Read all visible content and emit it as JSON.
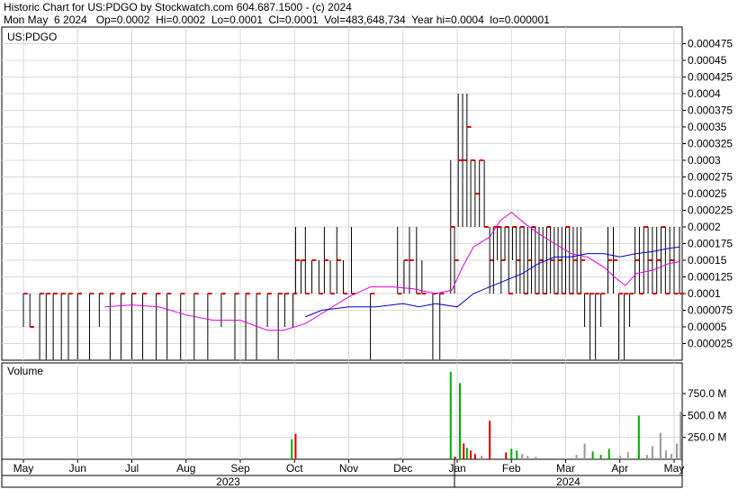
{
  "header": {
    "line1": "Historic Chart for US:PDGO by Stockwatch.com 604.687.1500 - (c) 2024",
    "line2": "Mon May  6 2024   Op=0.0002  Hi=0.0002  Lo=0.0001  Cl=0.0001  Vol=483,648,734  Year hi=0.0004  lo=0.000001"
  },
  "chart_data": [
    {
      "type": "line",
      "title": "US:PDGO",
      "ylim": [
        0,
        0.0005
      ],
      "y_ticks": [
        "0.000475",
        "0.00045",
        "0.000425",
        "0.0004",
        "0.000375",
        "0.00035",
        "0.000325",
        "0.0003",
        "0.000275",
        "0.00025",
        "0.000225",
        "0.0002",
        "0.000175",
        "0.00015",
        "0.000125",
        "0.0001",
        "0.000075",
        "0.00005",
        "0.000025"
      ],
      "y_tick_values": [
        0.000475,
        0.00045,
        0.000425,
        0.0004,
        0.000375,
        0.00035,
        0.000325,
        0.0003,
        0.000275,
        0.00025,
        0.000225,
        0.0002,
        0.000175,
        0.00015,
        0.000125,
        0.0001,
        7.5e-05,
        5e-05,
        2.5e-05
      ],
      "x_months": [
        "May",
        "Jun",
        "Jul",
        "Aug",
        "Sep",
        "Oct",
        "Nov",
        "Dec",
        "Jan",
        "Feb",
        "Mar",
        "Apr",
        "May"
      ],
      "x_years": [
        "2023",
        "2024"
      ],
      "grid": true,
      "colors": {
        "price": "#000000",
        "close_tick": "#dd0000",
        "ma_fast": "#e000e0",
        "ma_slow": "#0000cc"
      },
      "price_bars": [
        {
          "x": 0.0,
          "lo": 5e-05,
          "hi": 0.0001,
          "c": 0.0001
        },
        {
          "x": 0.12,
          "lo": 5e-05,
          "hi": 0.0001,
          "c": 5e-05
        },
        {
          "x": 0.3,
          "lo": 1e-06,
          "hi": 0.0001,
          "c": 0.0001
        },
        {
          "x": 0.42,
          "lo": 1e-06,
          "hi": 0.0001,
          "c": 0.0001
        },
        {
          "x": 0.55,
          "lo": 1e-06,
          "hi": 0.0001,
          "c": 0.0001
        },
        {
          "x": 0.7,
          "lo": 1e-06,
          "hi": 0.0001,
          "c": 0.0001
        },
        {
          "x": 0.83,
          "lo": 1e-06,
          "hi": 0.0001,
          "c": 0.0001
        },
        {
          "x": 1.0,
          "lo": 1e-06,
          "hi": 0.0001,
          "c": 0.0001
        },
        {
          "x": 1.22,
          "lo": 1e-06,
          "hi": 0.0001,
          "c": 0.0001
        },
        {
          "x": 1.4,
          "lo": 5e-05,
          "hi": 0.0001,
          "c": 0.0001
        },
        {
          "x": 1.6,
          "lo": 1e-06,
          "hi": 0.0001,
          "c": 0.0001
        },
        {
          "x": 1.8,
          "lo": 1e-06,
          "hi": 0.0001,
          "c": 0.0001
        },
        {
          "x": 2.0,
          "lo": 1e-06,
          "hi": 0.0001,
          "c": 0.0001
        },
        {
          "x": 2.2,
          "lo": 1e-06,
          "hi": 0.0001,
          "c": 0.0001
        },
        {
          "x": 2.45,
          "lo": 1e-06,
          "hi": 0.0001,
          "c": 0.0001
        },
        {
          "x": 2.65,
          "lo": 1e-06,
          "hi": 0.0001,
          "c": 0.0001
        },
        {
          "x": 2.9,
          "lo": 1e-06,
          "hi": 0.0001,
          "c": 0.0001
        },
        {
          "x": 3.15,
          "lo": 1e-06,
          "hi": 0.0001,
          "c": 0.0001
        },
        {
          "x": 3.4,
          "lo": 1e-06,
          "hi": 0.0001,
          "c": 0.0001
        },
        {
          "x": 3.65,
          "lo": 5e-05,
          "hi": 0.0001,
          "c": 0.0001
        },
        {
          "x": 3.9,
          "lo": 1e-06,
          "hi": 0.0001,
          "c": 0.0001
        },
        {
          "x": 4.1,
          "lo": 1e-06,
          "hi": 0.0001,
          "c": 0.0001
        },
        {
          "x": 4.3,
          "lo": 1e-06,
          "hi": 0.0001,
          "c": 0.0001
        },
        {
          "x": 4.5,
          "lo": 5e-05,
          "hi": 0.0001,
          "c": 0.0001
        },
        {
          "x": 4.7,
          "lo": 1e-06,
          "hi": 0.0001,
          "c": 0.0001
        },
        {
          "x": 4.82,
          "lo": 5e-05,
          "hi": 0.0001,
          "c": 0.0001
        },
        {
          "x": 4.97,
          "lo": 5e-05,
          "hi": 0.0001,
          "c": 0.0001
        },
        {
          "x": 5.02,
          "lo": 0.0001,
          "hi": 0.0002,
          "c": 0.00015
        },
        {
          "x": 5.12,
          "lo": 0.0001,
          "hi": 0.00015,
          "c": 0.00015
        },
        {
          "x": 5.2,
          "lo": 0.0001,
          "hi": 0.0002,
          "c": 0.0001
        },
        {
          "x": 5.32,
          "lo": 0.0001,
          "hi": 0.00015,
          "c": 0.00015
        },
        {
          "x": 5.45,
          "lo": 0.0001,
          "hi": 0.00015,
          "c": 0.0001
        },
        {
          "x": 5.55,
          "lo": 0.0001,
          "hi": 0.0002,
          "c": 0.00015
        },
        {
          "x": 5.66,
          "lo": 0.0001,
          "hi": 0.00015,
          "c": 0.0001
        },
        {
          "x": 5.78,
          "lo": 0.0001,
          "hi": 0.0002,
          "c": 0.00015
        },
        {
          "x": 5.9,
          "lo": 0.0001,
          "hi": 0.00015,
          "c": 0.0001
        },
        {
          "x": 6.05,
          "lo": 0.0001,
          "hi": 0.0002,
          "c": 0.0001
        },
        {
          "x": 6.4,
          "lo": 1e-06,
          "hi": 0.0001,
          "c": 0.0001
        },
        {
          "x": 6.9,
          "lo": 0.0001,
          "hi": 0.0002,
          "c": 0.0001
        },
        {
          "x": 7.02,
          "lo": 0.0001,
          "hi": 0.00015,
          "c": 0.00015
        },
        {
          "x": 7.12,
          "lo": 0.0001,
          "hi": 0.0002,
          "c": 0.00015
        },
        {
          "x": 7.25,
          "lo": 0.0001,
          "hi": 0.0002,
          "c": 0.0001
        },
        {
          "x": 7.35,
          "lo": 0.0001,
          "hi": 0.00015,
          "c": 0.0001
        },
        {
          "x": 7.55,
          "lo": 1e-06,
          "hi": 0.0001,
          "c": 0.0001
        },
        {
          "x": 7.68,
          "lo": 1e-06,
          "hi": 0.0001,
          "c": 0.0001
        },
        {
          "x": 7.88,
          "lo": 0.0001,
          "hi": 0.0003,
          "c": 0.0002
        },
        {
          "x": 7.95,
          "lo": 0.0001,
          "hi": 0.0002,
          "c": 0.00015
        },
        {
          "x": 8.02,
          "lo": 0.0002,
          "hi": 0.0004,
          "c": 0.0003
        },
        {
          "x": 8.1,
          "lo": 0.0002,
          "hi": 0.0004,
          "c": 0.0003
        },
        {
          "x": 8.18,
          "lo": 0.0002,
          "hi": 0.0004,
          "c": 0.00035
        },
        {
          "x": 8.25,
          "lo": 0.0002,
          "hi": 0.0003,
          "c": 0.0003
        },
        {
          "x": 8.33,
          "lo": 0.0002,
          "hi": 0.0003,
          "c": 0.00025
        },
        {
          "x": 8.41,
          "lo": 0.0002,
          "hi": 0.0003,
          "c": 0.0003
        },
        {
          "x": 8.5,
          "lo": 0.0002,
          "hi": 0.0003,
          "c": 0.0002
        },
        {
          "x": 8.6,
          "lo": 0.0001,
          "hi": 0.0002,
          "c": 0.00015
        },
        {
          "x": 8.67,
          "lo": 0.0001,
          "hi": 0.0002,
          "c": 0.0002
        },
        {
          "x": 8.74,
          "lo": 0.00015,
          "hi": 0.0002,
          "c": 0.0002
        },
        {
          "x": 8.81,
          "lo": 0.0001,
          "hi": 0.0002,
          "c": 0.00015
        },
        {
          "x": 8.88,
          "lo": 0.00015,
          "hi": 0.0002,
          "c": 0.0002
        },
        {
          "x": 8.95,
          "lo": 0.0001,
          "hi": 0.0002,
          "c": 0.0001
        },
        {
          "x": 9.02,
          "lo": 0.00015,
          "hi": 0.0002,
          "c": 0.0002
        },
        {
          "x": 9.09,
          "lo": 0.0001,
          "hi": 0.0002,
          "c": 0.00015
        },
        {
          "x": 9.16,
          "lo": 0.0001,
          "hi": 0.0002,
          "c": 0.0002
        },
        {
          "x": 9.23,
          "lo": 0.0001,
          "hi": 0.0002,
          "c": 0.0001
        },
        {
          "x": 9.3,
          "lo": 0.0001,
          "hi": 0.0002,
          "c": 0.00015
        },
        {
          "x": 9.37,
          "lo": 0.0001,
          "hi": 0.0002,
          "c": 0.0002
        },
        {
          "x": 9.44,
          "lo": 0.0001,
          "hi": 0.0002,
          "c": 0.0001
        },
        {
          "x": 9.51,
          "lo": 0.0001,
          "hi": 0.0002,
          "c": 0.00015
        },
        {
          "x": 9.58,
          "lo": 0.0001,
          "hi": 0.0002,
          "c": 0.0001
        },
        {
          "x": 9.65,
          "lo": 0.0001,
          "hi": 0.0002,
          "c": 0.0002
        },
        {
          "x": 9.72,
          "lo": 0.0001,
          "hi": 0.0002,
          "c": 0.00015
        },
        {
          "x": 9.79,
          "lo": 0.0001,
          "hi": 0.0002,
          "c": 0.0001
        },
        {
          "x": 9.86,
          "lo": 0.0001,
          "hi": 0.0002,
          "c": 0.00015
        },
        {
          "x": 9.93,
          "lo": 0.0001,
          "hi": 0.0002,
          "c": 0.0001
        },
        {
          "x": 10.0,
          "lo": 0.0001,
          "hi": 0.0002,
          "c": 0.0002
        },
        {
          "x": 10.07,
          "lo": 0.0001,
          "hi": 0.0002,
          "c": 0.0001
        },
        {
          "x": 10.14,
          "lo": 0.0001,
          "hi": 0.0002,
          "c": 0.00015
        },
        {
          "x": 10.21,
          "lo": 0.0001,
          "hi": 0.0002,
          "c": 0.0001
        },
        {
          "x": 10.28,
          "lo": 0.0001,
          "hi": 0.0002,
          "c": 0.00015
        },
        {
          "x": 10.35,
          "lo": 5e-05,
          "hi": 0.0001,
          "c": 0.0001
        },
        {
          "x": 10.45,
          "lo": 1e-06,
          "hi": 0.0001,
          "c": 0.0001
        },
        {
          "x": 10.55,
          "lo": 1e-06,
          "hi": 0.0001,
          "c": 0.0001
        },
        {
          "x": 10.65,
          "lo": 5e-05,
          "hi": 0.0001,
          "c": 0.0001
        },
        {
          "x": 10.78,
          "lo": 0.0001,
          "hi": 0.0002,
          "c": 0.00015
        },
        {
          "x": 10.88,
          "lo": 0.0001,
          "hi": 0.0002,
          "c": 0.00015
        },
        {
          "x": 10.98,
          "lo": 1e-06,
          "hi": 0.0001,
          "c": 0.0001
        },
        {
          "x": 11.08,
          "lo": 1e-06,
          "hi": 0.0001,
          "c": 0.0001
        },
        {
          "x": 11.18,
          "lo": 5e-05,
          "hi": 0.0001,
          "c": 0.0001
        },
        {
          "x": 11.28,
          "lo": 0.0001,
          "hi": 0.0002,
          "c": 0.00015
        },
        {
          "x": 11.36,
          "lo": 0.0001,
          "hi": 0.0002,
          "c": 0.0001
        },
        {
          "x": 11.44,
          "lo": 0.0001,
          "hi": 0.0002,
          "c": 0.0002
        },
        {
          "x": 11.52,
          "lo": 0.0001,
          "hi": 0.0002,
          "c": 0.00015
        },
        {
          "x": 11.6,
          "lo": 0.0001,
          "hi": 0.0002,
          "c": 0.0001
        },
        {
          "x": 11.68,
          "lo": 0.0001,
          "hi": 0.0002,
          "c": 0.00015
        },
        {
          "x": 11.76,
          "lo": 0.0001,
          "hi": 0.0002,
          "c": 0.0002
        },
        {
          "x": 11.84,
          "lo": 0.0001,
          "hi": 0.0002,
          "c": 0.0001
        },
        {
          "x": 11.92,
          "lo": 0.0001,
          "hi": 0.0002,
          "c": 0.00015
        },
        {
          "x": 12.0,
          "lo": 0.0001,
          "hi": 0.0002,
          "c": 0.0001
        },
        {
          "x": 12.1,
          "lo": 0.0001,
          "hi": 0.0002,
          "c": 0.0001
        }
      ],
      "ma_fast": [
        [
          1.5,
          8e-05
        ],
        [
          2.0,
          8.3e-05
        ],
        [
          2.5,
          8e-05
        ],
        [
          3.0,
          6.8e-05
        ],
        [
          3.5,
          6e-05
        ],
        [
          4.0,
          6e-05
        ],
        [
          4.5,
          4.5e-05
        ],
        [
          4.8,
          4.5e-05
        ],
        [
          5.2,
          5.5e-05
        ],
        [
          5.6,
          7.5e-05
        ],
        [
          6.0,
          9.5e-05
        ],
        [
          6.4,
          0.00011
        ],
        [
          6.8,
          0.00011
        ],
        [
          7.2,
          0.000107
        ],
        [
          7.6,
          0.0001
        ],
        [
          7.9,
          0.000105
        ],
        [
          8.1,
          0.00014
        ],
        [
          8.3,
          0.00017
        ],
        [
          8.6,
          0.000185
        ],
        [
          8.8,
          0.00021
        ],
        [
          9.0,
          0.000222
        ],
        [
          9.25,
          0.000205
        ],
        [
          9.5,
          0.00019
        ],
        [
          9.8,
          0.000175
        ],
        [
          10.1,
          0.00016
        ],
        [
          10.4,
          0.000155
        ],
        [
          10.7,
          0.00014
        ],
        [
          10.9,
          0.000125
        ],
        [
          11.1,
          0.000112
        ],
        [
          11.3,
          0.00013
        ],
        [
          11.6,
          0.000135
        ],
        [
          11.9,
          0.000145
        ],
        [
          12.1,
          0.000148
        ]
      ],
      "ma_slow": [
        [
          5.2,
          6.5e-05
        ],
        [
          5.5,
          7.5e-05
        ],
        [
          6.0,
          8e-05
        ],
        [
          6.5,
          8e-05
        ],
        [
          7.0,
          8.5e-05
        ],
        [
          7.3,
          8e-05
        ],
        [
          7.6,
          8.5e-05
        ],
        [
          8.0,
          8e-05
        ],
        [
          8.3,
          0.0001
        ],
        [
          8.6,
          0.00011
        ],
        [
          8.9,
          0.00012
        ],
        [
          9.2,
          0.00013
        ],
        [
          9.5,
          0.000145
        ],
        [
          9.8,
          0.000155
        ],
        [
          10.1,
          0.000155
        ],
        [
          10.4,
          0.00016
        ],
        [
          10.7,
          0.00016
        ],
        [
          11.0,
          0.000155
        ],
        [
          11.3,
          0.00016
        ],
        [
          11.6,
          0.000163
        ],
        [
          11.9,
          0.000168
        ],
        [
          12.1,
          0.00017
        ]
      ]
    },
    {
      "type": "bar",
      "title": "Volume",
      "ylim": [
        0,
        1100
      ],
      "y_ticks": [
        "750.0 M",
        "500.0 M",
        "250.0 M"
      ],
      "y_tick_values": [
        750,
        500,
        250
      ],
      "unit": "M",
      "colors": {
        "up": "#00aa00",
        "down": "#dd0000",
        "flat": "#999999"
      },
      "bars": [
        {
          "x": 4.95,
          "v": 230,
          "d": "up"
        },
        {
          "x": 5.02,
          "v": 290,
          "d": "down"
        },
        {
          "x": 6.95,
          "v": 20,
          "d": "flat"
        },
        {
          "x": 7.88,
          "v": 1000,
          "d": "up"
        },
        {
          "x": 7.96,
          "v": 30,
          "d": "down"
        },
        {
          "x": 8.05,
          "v": 870,
          "d": "up"
        },
        {
          "x": 8.12,
          "v": 180,
          "d": "down"
        },
        {
          "x": 8.18,
          "v": 130,
          "d": "up"
        },
        {
          "x": 8.25,
          "v": 100,
          "d": "down"
        },
        {
          "x": 8.33,
          "v": 60,
          "d": "down"
        },
        {
          "x": 8.45,
          "v": 40,
          "d": "flat"
        },
        {
          "x": 8.6,
          "v": 440,
          "d": "down"
        },
        {
          "x": 8.9,
          "v": 80,
          "d": "down"
        },
        {
          "x": 9.0,
          "v": 120,
          "d": "up"
        },
        {
          "x": 9.1,
          "v": 100,
          "d": "up"
        },
        {
          "x": 9.2,
          "v": 60,
          "d": "flat"
        },
        {
          "x": 9.3,
          "v": 40,
          "d": "flat"
        },
        {
          "x": 9.45,
          "v": 30,
          "d": "flat"
        },
        {
          "x": 10.2,
          "v": 50,
          "d": "flat"
        },
        {
          "x": 10.35,
          "v": 180,
          "d": "flat"
        },
        {
          "x": 10.5,
          "v": 90,
          "d": "up"
        },
        {
          "x": 10.65,
          "v": 50,
          "d": "up"
        },
        {
          "x": 10.8,
          "v": 120,
          "d": "up"
        },
        {
          "x": 11.0,
          "v": 40,
          "d": "flat"
        },
        {
          "x": 11.15,
          "v": 80,
          "d": "flat"
        },
        {
          "x": 11.35,
          "v": 500,
          "d": "up"
        },
        {
          "x": 11.5,
          "v": 50,
          "d": "flat"
        },
        {
          "x": 11.6,
          "v": 150,
          "d": "flat"
        },
        {
          "x": 11.75,
          "v": 300,
          "d": "flat"
        },
        {
          "x": 11.85,
          "v": 100,
          "d": "flat"
        },
        {
          "x": 11.95,
          "v": 60,
          "d": "flat"
        },
        {
          "x": 12.05,
          "v": 180,
          "d": "flat"
        },
        {
          "x": 12.12,
          "v": 540,
          "d": "flat"
        }
      ]
    }
  ]
}
